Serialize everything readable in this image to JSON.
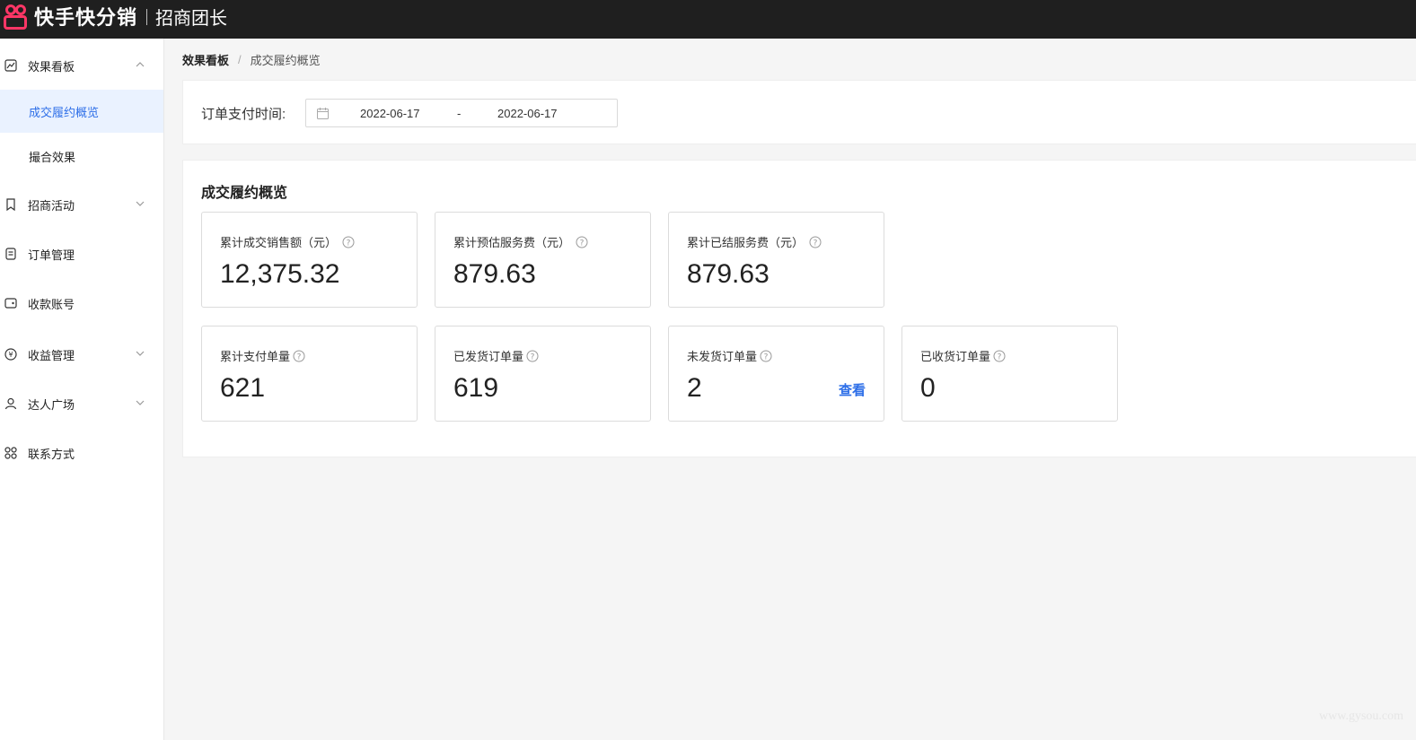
{
  "header": {
    "brand": "快手快分销",
    "subtitle": "招商团长"
  },
  "sidebar": {
    "items": [
      {
        "label": "效果看板",
        "icon": "chart-icon",
        "chevron": "up"
      },
      {
        "label": "成交履约概览",
        "active": true
      },
      {
        "label": "撮合效果"
      },
      {
        "label": "招商活动",
        "icon": "bookmark-icon",
        "chevron": "down"
      },
      {
        "label": "订单管理",
        "icon": "order-icon"
      },
      {
        "label": "收款账号",
        "icon": "wallet-icon"
      },
      {
        "label": "收益管理",
        "icon": "coin-icon",
        "chevron": "down"
      },
      {
        "label": "达人广场",
        "icon": "user-icon",
        "chevron": "down"
      },
      {
        "label": "联系方式",
        "icon": "grid-icon"
      }
    ]
  },
  "breadcrumb": {
    "first": "效果看板",
    "separator": "/",
    "current": "成交履约概览"
  },
  "filter": {
    "label": "订单支付时间:",
    "start_date": "2022-06-17",
    "dash": "-",
    "end_date": "2022-06-17"
  },
  "stats": {
    "title": "成交履约概览",
    "cards": [
      {
        "label": "累计成交销售额（元）",
        "value": "12,375.32"
      },
      {
        "label": "累计预估服务费（元）",
        "value": "879.63"
      },
      {
        "label": "累计已结服务费（元）",
        "value": "879.63"
      },
      {
        "label": "累计支付单量",
        "value": "621"
      },
      {
        "label": "已发货订单量",
        "value": "619"
      },
      {
        "label": "未发货订单量",
        "value": "2",
        "link": "查看"
      },
      {
        "label": "已收货订单量",
        "value": "0"
      }
    ]
  },
  "watermark": "www.gysou.com",
  "colors": {
    "accent": "#2e6fe8",
    "topbar": "#1f1f1f",
    "brand": "#fe3666",
    "active_bg": "#eaf2ff"
  }
}
